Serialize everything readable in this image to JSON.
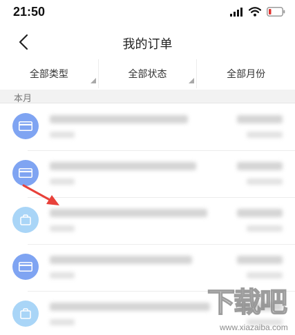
{
  "status_bar": {
    "time": "21:50",
    "icons": [
      "signal-icon",
      "wifi-icon",
      "battery-low-icon"
    ],
    "battery_color": "#e0322e"
  },
  "header": {
    "back_icon": "chevron-left-icon",
    "title": "我的订单"
  },
  "filters": [
    {
      "label": "全部类型"
    },
    {
      "label": "全部状态"
    },
    {
      "label": "全部月份"
    }
  ],
  "month_section": {
    "label": "本月"
  },
  "orders": [
    {
      "icon": "card-icon",
      "blurred": true
    },
    {
      "icon": "card-icon",
      "blurred": true
    },
    {
      "icon": "bag-icon",
      "blurred": true
    },
    {
      "icon": "card-icon",
      "blurred": true
    },
    {
      "icon": "bag-icon",
      "blurred": true
    }
  ],
  "annotation": {
    "arrow_color": "#e8413a"
  },
  "watermark": {
    "site_name": "下载吧",
    "domain": "www.xiazaiba.com"
  }
}
